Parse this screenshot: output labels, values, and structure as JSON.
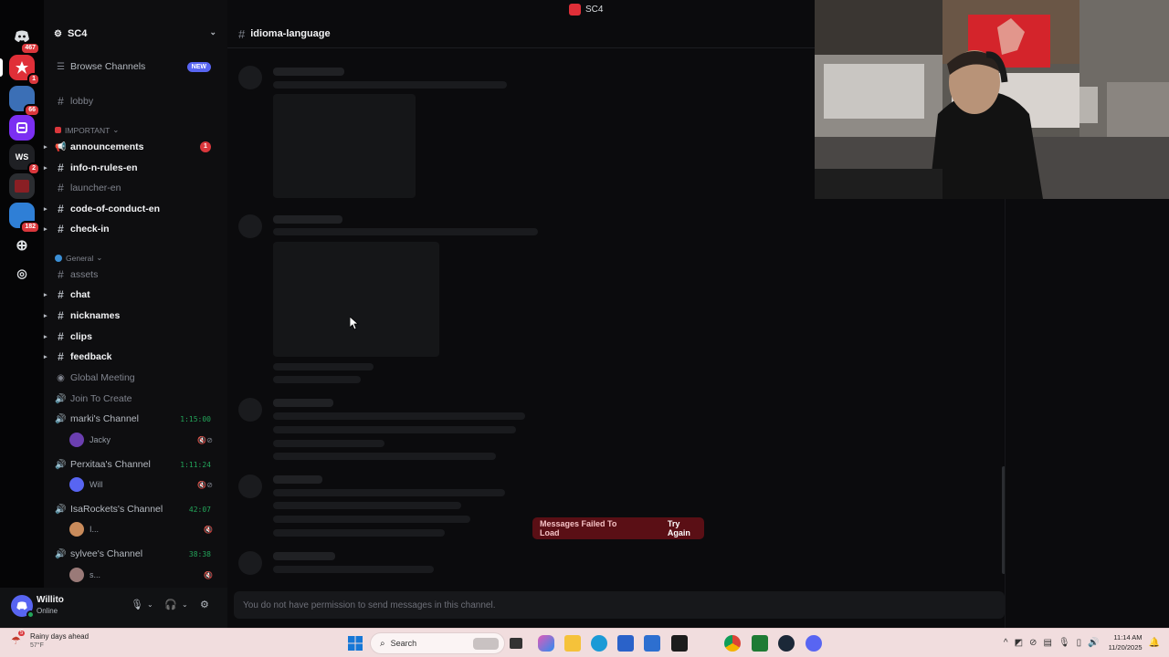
{
  "window": {
    "title": "SC4"
  },
  "server": {
    "name": "SC4"
  },
  "rail": {
    "servers": [
      {
        "label": "",
        "color": "#2b2d31",
        "badge": "467"
      },
      {
        "label": "",
        "color": "#e02f38",
        "badge": "1"
      },
      {
        "label": "",
        "color": "#3b6fb6",
        "badge": "66"
      },
      {
        "label": "",
        "color": "#7b2ff2",
        "badge": ""
      },
      {
        "label": "WS",
        "color": "#1f2024",
        "badge": "2"
      },
      {
        "label": "",
        "color": "#8a1f24",
        "badge": ""
      },
      {
        "label": "",
        "color": "#2f7fd6",
        "badge": "182"
      }
    ]
  },
  "sidebar": {
    "browse_channels": "Browse Channels",
    "browse_badge": "NEW",
    "lobby": "lobby",
    "important_category": "IMPORTANT",
    "important_channels": [
      {
        "name": "announcements",
        "badge": "1"
      },
      {
        "name": "info-n-rules-en",
        "badge": ""
      },
      {
        "name": "launcher-en",
        "badge": ""
      },
      {
        "name": "code-of-conduct-en",
        "badge": ""
      },
      {
        "name": "check-in",
        "badge": ""
      }
    ],
    "general_category": "General",
    "general_channels": [
      "assets",
      "chat",
      "nicknames",
      "clips",
      "feedback"
    ],
    "voice": {
      "global_meeting": "Global Meeting",
      "join_to_create": "Join To Create",
      "channels": [
        {
          "name": "marki's Channel",
          "time": "1:15:00",
          "member": "Jacky",
          "member_color": "#6b3fb0"
        },
        {
          "name": "Perxitaa's Channel",
          "time": "1:11:24",
          "member": "Will",
          "member_color": "#5865f2"
        },
        {
          "name": "IsaRockets's Channel",
          "time": "42:07",
          "member": "I...",
          "member_color": "#c98b5b"
        },
        {
          "name": "sylvee's Channel",
          "time": "38:38",
          "member": "s...",
          "member_color": "#9a7a78"
        }
      ]
    }
  },
  "user_panel": {
    "username": "Willito",
    "status": "Online"
  },
  "channel": {
    "name": "idioma-language"
  },
  "messages": {
    "error_text": "Messages Failed To Load",
    "retry_label": "Try Again"
  },
  "composer": {
    "placeholder": "You do not have permission to send messages in this channel."
  },
  "taskbar": {
    "weather_title": "Rainy days ahead",
    "weather_temp": "57°F",
    "weather_badge": "5",
    "search_placeholder": "Search",
    "time": "11:14 AM",
    "date": "11/20/2025"
  }
}
